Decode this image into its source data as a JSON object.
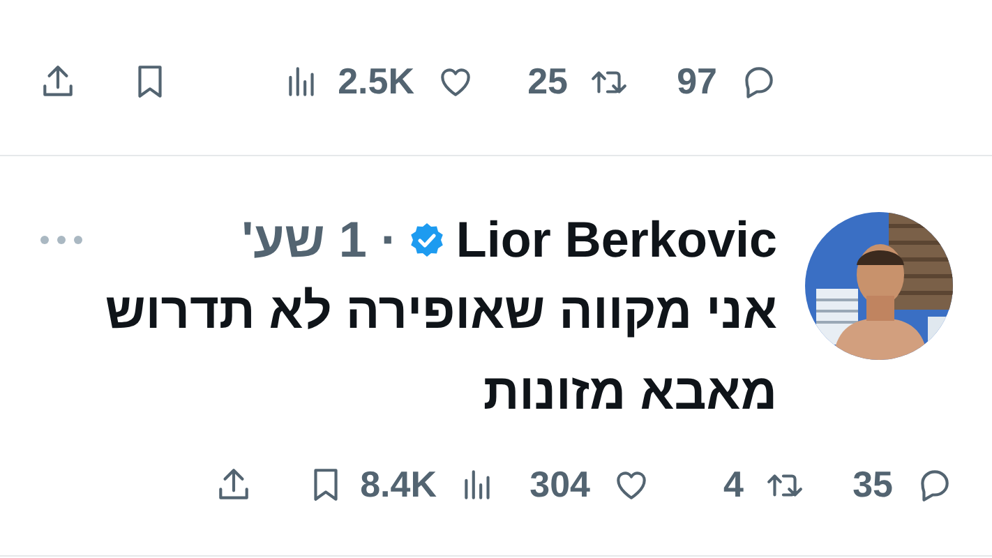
{
  "previous_tweet": {
    "actions": [
      {
        "kind": "reply",
        "count": "97"
      },
      {
        "kind": "retweet",
        "count": "25"
      },
      {
        "kind": "like",
        "count": "2.5K"
      },
      {
        "kind": "views"
      },
      {
        "kind": "bookmark"
      },
      {
        "kind": "share"
      }
    ]
  },
  "tweet": {
    "author": "Lior Berkovic",
    "verified": true,
    "time": "· 1 שע'",
    "lines": [
      "אני מקווה שאופירה לא תדרוש",
      "מאבא מזונות"
    ],
    "actions": [
      {
        "kind": "reply",
        "count": "35"
      },
      {
        "kind": "retweet",
        "count": "4"
      },
      {
        "kind": "like",
        "count": "304"
      },
      {
        "kind": "views",
        "count": "8.4K"
      },
      {
        "kind": "bookmark"
      },
      {
        "kind": "share"
      }
    ]
  }
}
